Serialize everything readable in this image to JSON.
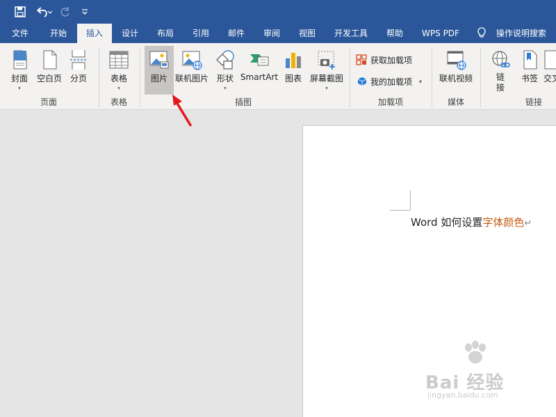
{
  "tabs": [
    {
      "label": "文件"
    },
    {
      "label": "开始"
    },
    {
      "label": "插入"
    },
    {
      "label": "设计"
    },
    {
      "label": "布局"
    },
    {
      "label": "引用"
    },
    {
      "label": "邮件"
    },
    {
      "label": "审阅"
    },
    {
      "label": "视图"
    },
    {
      "label": "开发工具"
    },
    {
      "label": "帮助"
    },
    {
      "label": "WPS PDF"
    }
  ],
  "active_tab": "插入",
  "tell_me": "操作说明搜索",
  "ribbon": {
    "pages": {
      "label": "页面",
      "cover": "封面",
      "blank": "空白页",
      "break": "分页"
    },
    "tables": {
      "label": "表格",
      "table": "表格"
    },
    "illustrations": {
      "label": "插图",
      "picture": "图片",
      "online_picture": "联机图片",
      "shapes": "形状",
      "smartart": "SmartArt",
      "chart": "图表",
      "screenshot": "屏幕截图"
    },
    "addins": {
      "label": "加载项",
      "get": "获取加载项",
      "mine": "我的加载项"
    },
    "media": {
      "label": "媒体",
      "online_video": "联机视频"
    },
    "links": {
      "label": "链接",
      "link": "链\n接",
      "bookmark": "书签",
      "crossref": "交叉"
    }
  },
  "document": {
    "text_plain": "Word 如何设置",
    "text_highlight": "字体颜色",
    "para_mark": "↵"
  },
  "watermark": {
    "main": "Bai 经验",
    "sub": "jingyan.baidu.com"
  },
  "colors": {
    "title_bar": "#2b579a",
    "ribbon_bg": "#f3f2f1",
    "highlight_text": "#c55a11",
    "arrow": "#e0191c"
  }
}
